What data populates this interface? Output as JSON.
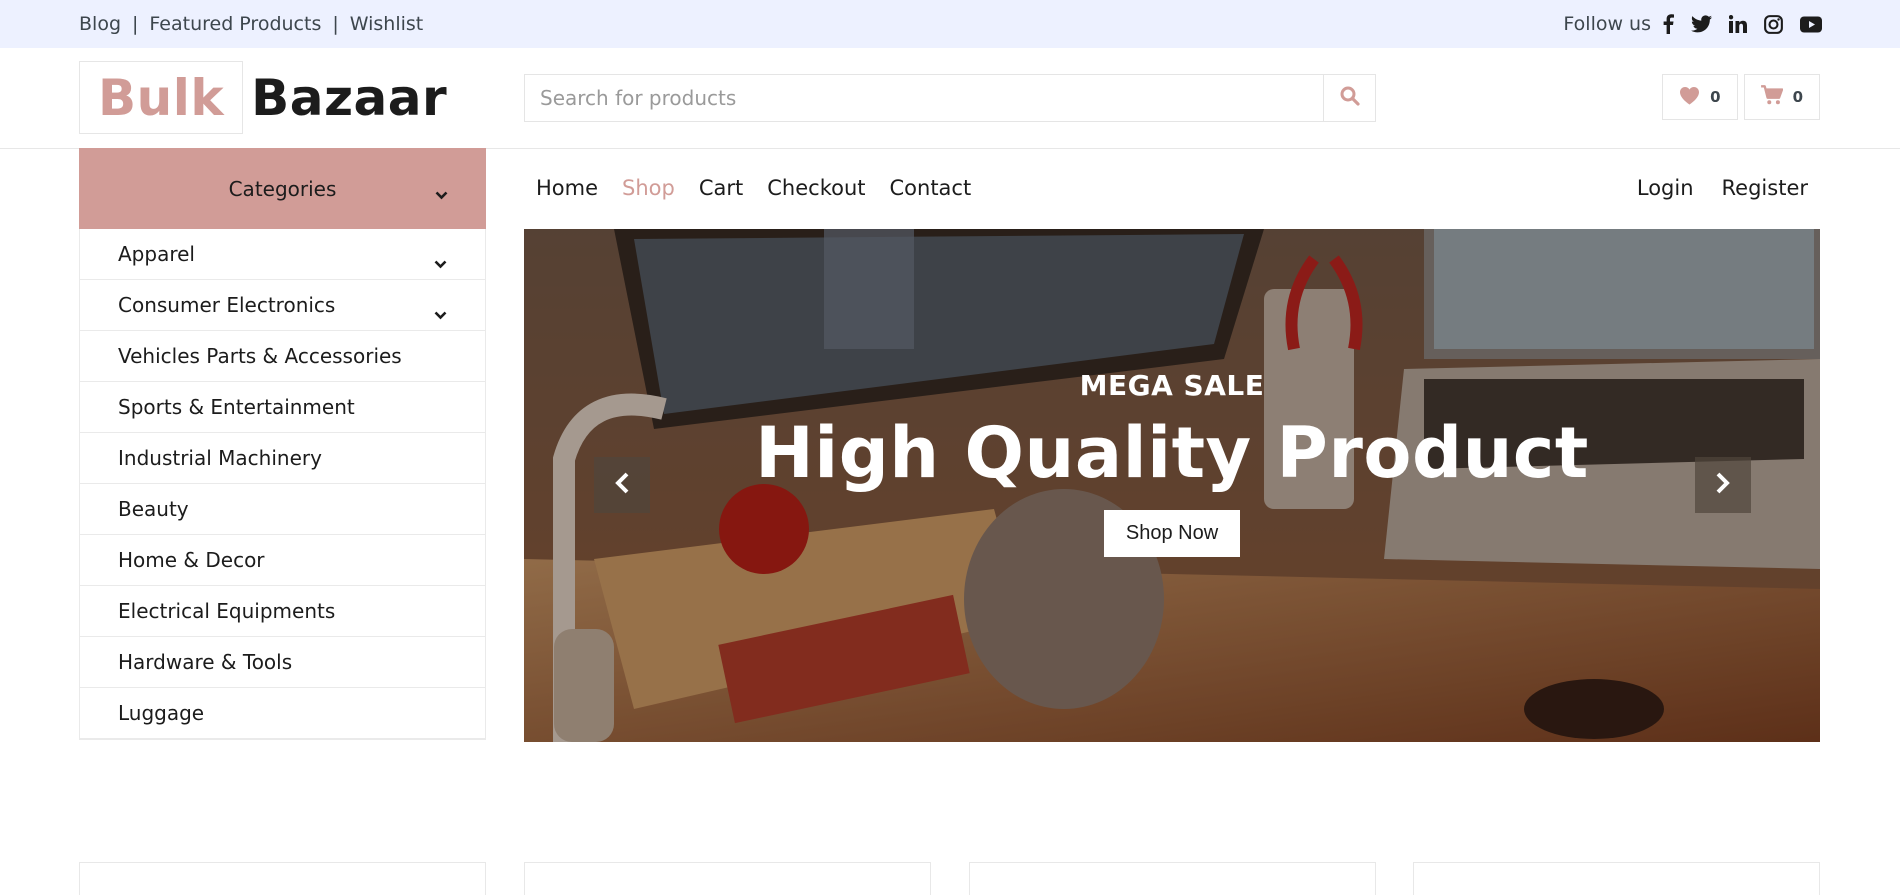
{
  "topbar": {
    "links": [
      "Blog",
      "Featured Products",
      "Wishlist"
    ],
    "separator": "|",
    "follow_label": "Follow us",
    "social_icons": [
      "facebook-icon",
      "twitter-icon",
      "linkedin-icon",
      "instagram-icon",
      "youtube-icon"
    ]
  },
  "logo": {
    "part1": "Bulk",
    "part2": "Bazaar"
  },
  "search": {
    "placeholder": "Search for products",
    "value": ""
  },
  "header_icons": {
    "wishlist_count": "0",
    "cart_count": "0"
  },
  "categories": {
    "title": "Categories",
    "items": [
      {
        "label": "Apparel",
        "has_children": true
      },
      {
        "label": "Consumer Electronics",
        "has_children": true
      },
      {
        "label": "Vehicles Parts & Accessories",
        "has_children": false
      },
      {
        "label": "Sports & Entertainment",
        "has_children": false
      },
      {
        "label": "Industrial Machinery",
        "has_children": false
      },
      {
        "label": "Beauty",
        "has_children": false
      },
      {
        "label": "Home & Decor",
        "has_children": false
      },
      {
        "label": "Electrical Equipments",
        "has_children": false
      },
      {
        "label": "Hardware & Tools",
        "has_children": false
      },
      {
        "label": "Luggage",
        "has_children": false
      }
    ]
  },
  "nav": {
    "items": [
      "Home",
      "Shop",
      "Cart",
      "Checkout",
      "Contact"
    ],
    "active": "Shop",
    "right": [
      "Login",
      "Register"
    ]
  },
  "hero": {
    "eyebrow": "MEGA SALE",
    "headline": "High Quality Product",
    "button": "Shop Now"
  },
  "colors": {
    "accent": "#d19c97",
    "topbar_bg": "#edf1ff",
    "text_dark": "#1c1c1c"
  }
}
